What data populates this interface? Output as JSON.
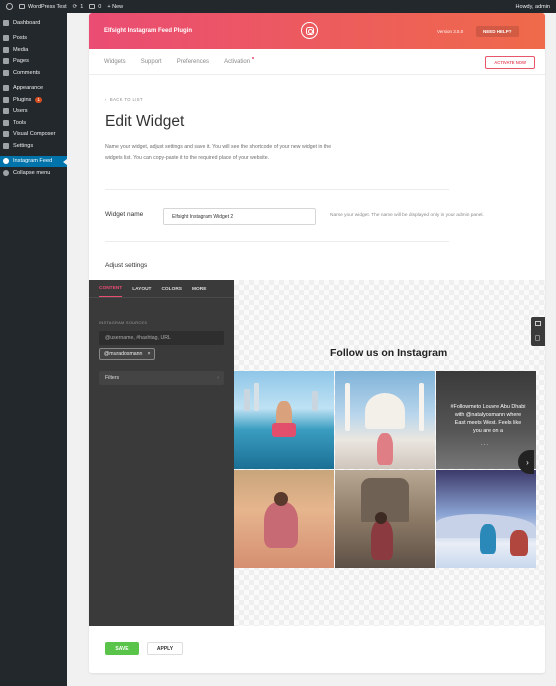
{
  "adminbar": {
    "site_name": "WordPress Test",
    "updates_count": "1",
    "comments_count": "0",
    "new_label": "+ New",
    "greeting": "Howdy, admin"
  },
  "sidebar": {
    "items": [
      {
        "label": "Dashboard"
      },
      {
        "label": "Posts"
      },
      {
        "label": "Media"
      },
      {
        "label": "Pages"
      },
      {
        "label": "Comments"
      },
      {
        "label": "Appearance"
      },
      {
        "label": "Plugins",
        "badge": "1"
      },
      {
        "label": "Users"
      },
      {
        "label": "Tools"
      },
      {
        "label": "Visual Composer"
      },
      {
        "label": "Settings"
      },
      {
        "label": "Instagram Feed"
      },
      {
        "label": "Collapse menu"
      }
    ]
  },
  "header": {
    "title": "Elfsight Instagram Feed Plugin",
    "version": "Version 3.5.0",
    "help_label": "NEED HELP?"
  },
  "nav": {
    "tabs": [
      "Widgets",
      "Support",
      "Preferences",
      "Activation"
    ],
    "activate_label": "ACTIVATE NOW"
  },
  "page": {
    "back_label": "BACK TO LIST",
    "title": "Edit Widget",
    "description": "Name your widget, adjust settings and save it. You will see the shortcode of your new widget in the widgets list. You can copy-paste it to the required place of your website.",
    "widget_name_label": "Widget name",
    "widget_name_value": "Elfsight Instagram Widget 2",
    "widget_name_hint": "Name your widget. The name will be displayed only in your admin panel.",
    "adjust_label": "Adjust settings"
  },
  "editor": {
    "tabs": [
      "CONTENT",
      "LAYOUT",
      "COLORS",
      "MORE"
    ],
    "sources_label": "INSTAGRAM SOURCES",
    "sources_placeholder": "@username, #hashtag, URL",
    "source_tag": "@muradosmann",
    "filters_label": "Filters"
  },
  "preview": {
    "heading": "Follow us on Instagram",
    "caption": "#Followmeto Louvre Abu Dhabi with @natalyosmann where East meets West. Feels like you are on a",
    "caption_more": "..."
  },
  "footer": {
    "save_label": "SAVE",
    "apply_label": "APPLY"
  },
  "colors": {
    "accent": "#ea4c73",
    "wp_active": "#0073aa",
    "save_green": "#5ac44a"
  }
}
